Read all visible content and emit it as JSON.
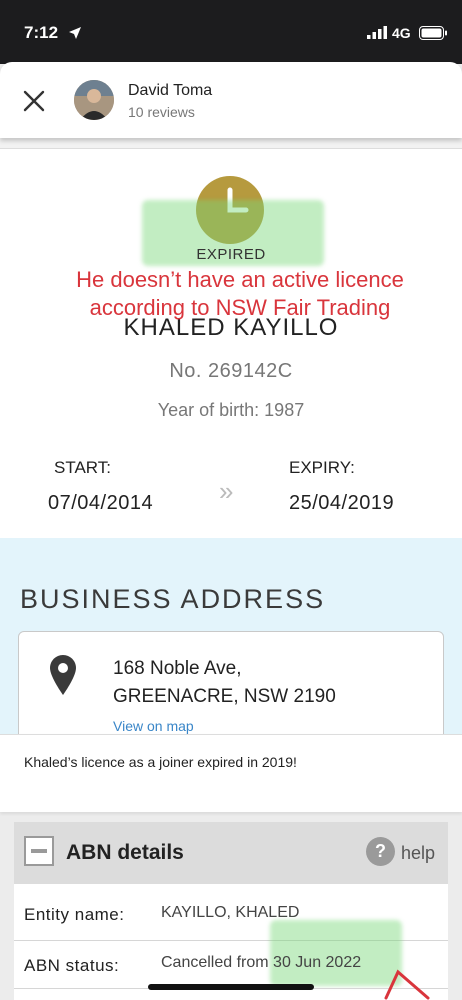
{
  "status_bar": {
    "time": "7:12",
    "network": "4G"
  },
  "review_header": {
    "reviewer_name": "David Toma",
    "review_count": "10 reviews"
  },
  "licence": {
    "status": "EXPIRED",
    "annotation": "He doesn’t have an active licence according to NSW Fair Trading",
    "licensee_name": "KHALED KAYILLO",
    "licence_number": "No. 269142C",
    "year_of_birth": "Year of birth: 1987",
    "start_label": "START:",
    "start_date": "07/04/2014",
    "expiry_label": "EXPIRY:",
    "expiry_date": "25/04/2019",
    "arrows": "»"
  },
  "business_address": {
    "title": "BUSINESS ADDRESS",
    "line1": "168 Noble Ave,",
    "line2": "GREENACRE, NSW 2190",
    "map_link": "View on map"
  },
  "caption": "Khaled’s licence as a joiner expired in 2019!",
  "abn_details": {
    "title": "ABN details",
    "help_label": "help",
    "help_icon": "?",
    "rows": [
      {
        "label": "Entity name:",
        "value": "KAYILLO, KHALED"
      },
      {
        "label": "ABN status:",
        "value": "Cancelled from 30 Jun 2022"
      }
    ]
  },
  "colors": {
    "annotation": "#d9353c",
    "highlight": "#78d778",
    "address_bg": "#e3f4fb",
    "clock": "#b69a3e",
    "link": "#3a86c8"
  }
}
